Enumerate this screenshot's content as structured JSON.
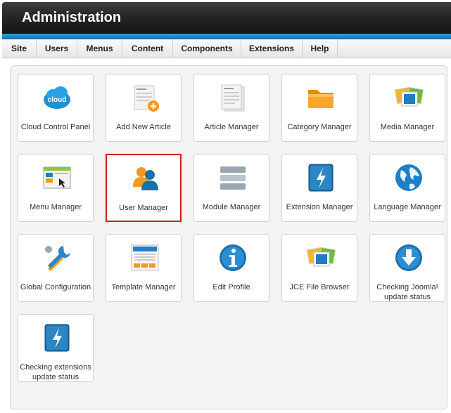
{
  "header": {
    "title": "Administration"
  },
  "menu": {
    "items": [
      "Site",
      "Users",
      "Menus",
      "Content",
      "Components",
      "Extensions",
      "Help"
    ]
  },
  "tiles": [
    {
      "label": "Cloud Control Panel",
      "icon": "cloud-icon"
    },
    {
      "label": "Add New Article",
      "icon": "add-article-icon"
    },
    {
      "label": "Article Manager",
      "icon": "article-icon"
    },
    {
      "label": "Category Manager",
      "icon": "folder-icon"
    },
    {
      "label": "Media Manager",
      "icon": "media-icon"
    },
    {
      "label": "Menu Manager",
      "icon": "menu-window-icon"
    },
    {
      "label": "User Manager",
      "icon": "users-icon",
      "selected": true
    },
    {
      "label": "Module Manager",
      "icon": "module-stack-icon"
    },
    {
      "label": "Extension Manager",
      "icon": "lightning-icon"
    },
    {
      "label": "Language Manager",
      "icon": "globe-icon"
    },
    {
      "label": "Global Configuration",
      "icon": "tools-icon"
    },
    {
      "label": "Template Manager",
      "icon": "template-icon"
    },
    {
      "label": "Edit Profile",
      "icon": "info-icon"
    },
    {
      "label": "JCE File Browser",
      "icon": "media-icon"
    },
    {
      "label": "Checking Joomla! update status",
      "icon": "download-icon"
    },
    {
      "label": "Checking extensions update status",
      "icon": "lightning-icon"
    }
  ],
  "colors": {
    "accent": "#2f9fdc",
    "header": "#262626",
    "selected_border": "#d11d1d"
  }
}
